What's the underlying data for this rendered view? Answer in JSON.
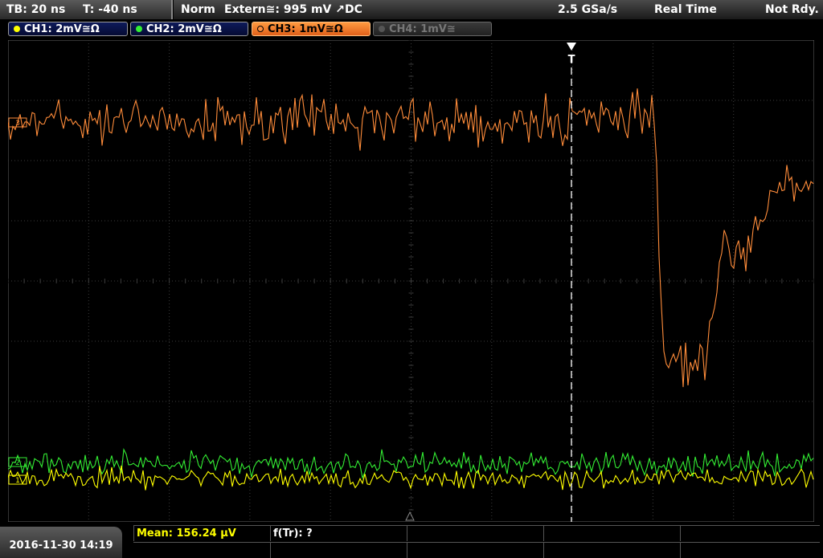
{
  "topbar": {
    "timebase": "TB: 20 ns",
    "trigger_time": "T: -40 ns",
    "mode": "Norm",
    "trigger_source": "Extern≅: 995 mV ↗DC",
    "sample_rate": "2.5 GSa/s",
    "acq_mode": "Real Time",
    "status": "Not Rdy."
  },
  "channels": [
    {
      "label": "CH1: 2mV≅Ω",
      "color": "#ffff00",
      "state": "on"
    },
    {
      "label": "CH2: 2mV≅Ω",
      "color": "#33ee33",
      "state": "on"
    },
    {
      "label": "CH3: 1mV≅Ω",
      "color": "#ff9040",
      "state": "active"
    },
    {
      "label": "CH4: 1mV≅",
      "color": "#777777",
      "state": "off"
    }
  ],
  "trigger_marker": "T",
  "markers": {
    "ch3": "3",
    "ch2": "2",
    "ch1": "1"
  },
  "colors": {
    "ch1": "#ffff00",
    "ch2": "#33ee33",
    "ch3": "#ff8c3a",
    "grid": "#3c3c3c"
  },
  "bottombar": {
    "datetime": "2016-11-30 14:19",
    "measurement_1": "Mean: 156.24 µV",
    "measurement_2": "f(Tr): ?"
  }
}
